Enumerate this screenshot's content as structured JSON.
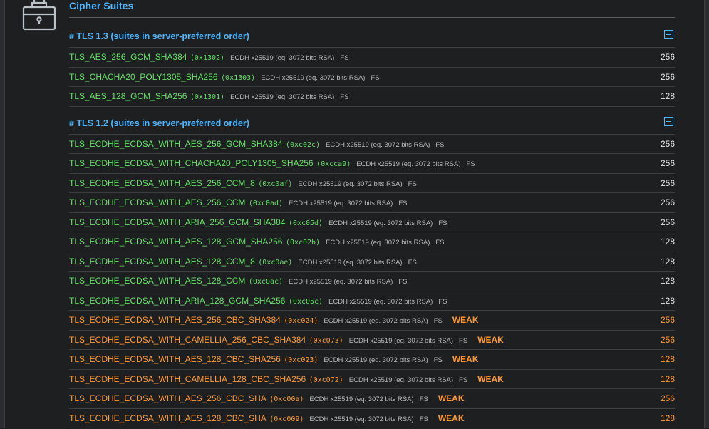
{
  "section": {
    "title": "Cipher Suites",
    "icon": "briefcase-lock-icon"
  },
  "groups": [
    {
      "header": "# TLS 1.3 (suites in server-preferred order)",
      "rows": [
        {
          "name": "TLS_AES_256_GCM_SHA384",
          "hex": "(0x1302)",
          "kx": "ECDH x25519 (eq. 3072 bits RSA)",
          "fs": "FS",
          "weak": "",
          "bits": "256"
        },
        {
          "name": "TLS_CHACHA20_POLY1305_SHA256",
          "hex": "(0x1303)",
          "kx": "ECDH x25519 (eq. 3072 bits RSA)",
          "fs": "FS",
          "weak": "",
          "bits": "256"
        },
        {
          "name": "TLS_AES_128_GCM_SHA256",
          "hex": "(0x1301)",
          "kx": "ECDH x25519 (eq. 3072 bits RSA)",
          "fs": "FS",
          "weak": "",
          "bits": "128"
        }
      ]
    },
    {
      "header": "# TLS 1.2 (suites in server-preferred order)",
      "rows": [
        {
          "name": "TLS_ECDHE_ECDSA_WITH_AES_256_GCM_SHA384",
          "hex": "(0xc02c)",
          "kx": "ECDH x25519 (eq. 3072 bits RSA)",
          "fs": "FS",
          "weak": "",
          "bits": "256"
        },
        {
          "name": "TLS_ECDHE_ECDSA_WITH_CHACHA20_POLY1305_SHA256",
          "hex": "(0xcca9)",
          "kx": "ECDH x25519 (eq. 3072 bits RSA)",
          "fs": "FS",
          "weak": "",
          "bits": "256"
        },
        {
          "name": "TLS_ECDHE_ECDSA_WITH_AES_256_CCM_8",
          "hex": "(0xc0af)",
          "kx": "ECDH x25519 (eq. 3072 bits RSA)",
          "fs": "FS",
          "weak": "",
          "bits": "256"
        },
        {
          "name": "TLS_ECDHE_ECDSA_WITH_AES_256_CCM",
          "hex": "(0xc0ad)",
          "kx": "ECDH x25519 (eq. 3072 bits RSA)",
          "fs": "FS",
          "weak": "",
          "bits": "256"
        },
        {
          "name": "TLS_ECDHE_ECDSA_WITH_ARIA_256_GCM_SHA384",
          "hex": "(0xc05d)",
          "kx": "ECDH x25519 (eq. 3072 bits RSA)",
          "fs": "FS",
          "weak": "",
          "bits": "256"
        },
        {
          "name": "TLS_ECDHE_ECDSA_WITH_AES_128_GCM_SHA256",
          "hex": "(0xc02b)",
          "kx": "ECDH x25519 (eq. 3072 bits RSA)",
          "fs": "FS",
          "weak": "",
          "bits": "128"
        },
        {
          "name": "TLS_ECDHE_ECDSA_WITH_AES_128_CCM_8",
          "hex": "(0xc0ae)",
          "kx": "ECDH x25519 (eq. 3072 bits RSA)",
          "fs": "FS",
          "weak": "",
          "bits": "128"
        },
        {
          "name": "TLS_ECDHE_ECDSA_WITH_AES_128_CCM",
          "hex": "(0xc0ac)",
          "kx": "ECDH x25519 (eq. 3072 bits RSA)",
          "fs": "FS",
          "weak": "",
          "bits": "128"
        },
        {
          "name": "TLS_ECDHE_ECDSA_WITH_ARIA_128_GCM_SHA256",
          "hex": "(0xc05c)",
          "kx": "ECDH x25519 (eq. 3072 bits RSA)",
          "fs": "FS",
          "weak": "",
          "bits": "128"
        },
        {
          "name": "TLS_ECDHE_ECDSA_WITH_AES_256_CBC_SHA384",
          "hex": "(0xc024)",
          "kx": "ECDH x25519 (eq. 3072 bits RSA)",
          "fs": "FS",
          "weak": "WEAK",
          "bits": "256"
        },
        {
          "name": "TLS_ECDHE_ECDSA_WITH_CAMELLIA_256_CBC_SHA384",
          "hex": "(0xc073)",
          "kx": "ECDH x25519 (eq. 3072 bits RSA)",
          "fs": "FS",
          "weak": "WEAK",
          "bits": "256"
        },
        {
          "name": "TLS_ECDHE_ECDSA_WITH_AES_128_CBC_SHA256",
          "hex": "(0xc023)",
          "kx": "ECDH x25519 (eq. 3072 bits RSA)",
          "fs": "FS",
          "weak": "WEAK",
          "bits": "128"
        },
        {
          "name": "TLS_ECDHE_ECDSA_WITH_CAMELLIA_128_CBC_SHA256",
          "hex": "(0xc072)",
          "kx": "ECDH x25519 (eq. 3072 bits RSA)",
          "fs": "FS",
          "weak": "WEAK",
          "bits": "128"
        },
        {
          "name": "TLS_ECDHE_ECDSA_WITH_AES_256_CBC_SHA",
          "hex": "(0xc00a)",
          "kx": "ECDH x25519 (eq. 3072 bits RSA)",
          "fs": "FS",
          "weak": "WEAK",
          "bits": "256"
        },
        {
          "name": "TLS_ECDHE_ECDSA_WITH_AES_128_CBC_SHA",
          "hex": "(0xc009)",
          "kx": "ECDH x25519 (eq. 3072 bits RSA)",
          "fs": "FS",
          "weak": "WEAK",
          "bits": "128"
        }
      ]
    }
  ],
  "colors": {
    "accent": "#4db6ff",
    "strong": "#66e066",
    "weak": "#ff9933",
    "muted": "#b8b8b8",
    "background": "#1d1f21"
  }
}
